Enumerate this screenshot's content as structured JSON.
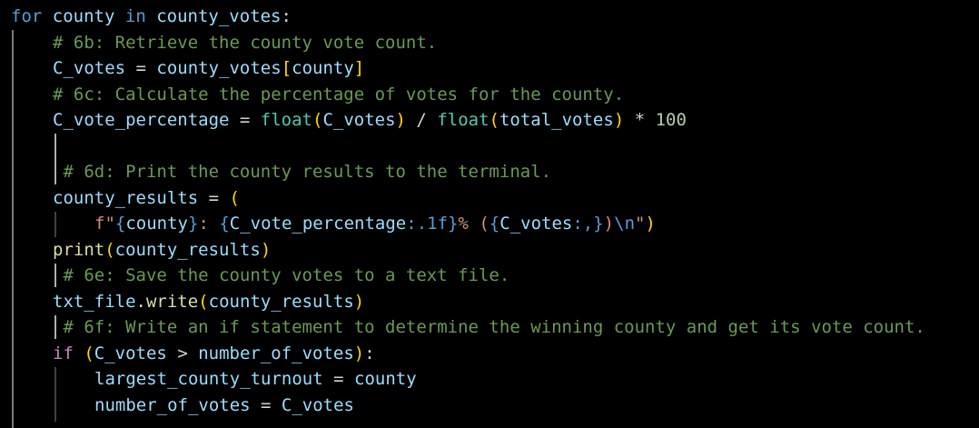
{
  "editor": {
    "colors": {
      "background": "#000000",
      "keyword": "#569cd6",
      "control": "#c586c0",
      "variable": "#9cdcfe",
      "function": "#dcdcaa",
      "builtin": "#4ec9b0",
      "string": "#ce9178",
      "number": "#b5cea8",
      "comment": "#6a9955",
      "plain": "#d4d4d4",
      "bracket1": "#ffd700",
      "bracket2": "#da70d6",
      "bracket3": "#179fff"
    },
    "lines": [
      {
        "indent": 0,
        "tokens": [
          {
            "t": "for",
            "c": "keyword"
          },
          {
            "t": " ",
            "c": "plain"
          },
          {
            "t": "county",
            "c": "variable"
          },
          {
            "t": " ",
            "c": "plain"
          },
          {
            "t": "in",
            "c": "keyword"
          },
          {
            "t": " ",
            "c": "plain"
          },
          {
            "t": "county_votes",
            "c": "variable"
          },
          {
            "t": ":",
            "c": "plain"
          }
        ]
      },
      {
        "indent": 1,
        "tokens": [
          {
            "t": "# 6b: Retrieve the county vote count.",
            "c": "comment"
          }
        ]
      },
      {
        "indent": 1,
        "tokens": [
          {
            "t": "C_votes",
            "c": "variable"
          },
          {
            "t": " = ",
            "c": "plain"
          },
          {
            "t": "county_votes",
            "c": "variable"
          },
          {
            "t": "[",
            "c": "bracket1"
          },
          {
            "t": "county",
            "c": "variable"
          },
          {
            "t": "]",
            "c": "bracket1"
          }
        ]
      },
      {
        "indent": 1,
        "tokens": [
          {
            "t": "# 6c: Calculate the percentage of votes for the county.",
            "c": "comment"
          }
        ]
      },
      {
        "indent": 1,
        "tokens": [
          {
            "t": "C_vote_percentage",
            "c": "variable"
          },
          {
            "t": " = ",
            "c": "plain"
          },
          {
            "t": "float",
            "c": "builtin"
          },
          {
            "t": "(",
            "c": "bracket1"
          },
          {
            "t": "C_votes",
            "c": "variable"
          },
          {
            "t": ")",
            "c": "bracket1"
          },
          {
            "t": " / ",
            "c": "plain"
          },
          {
            "t": "float",
            "c": "builtin"
          },
          {
            "t": "(",
            "c": "bracket1"
          },
          {
            "t": "total_votes",
            "c": "variable"
          },
          {
            "t": ")",
            "c": "bracket1"
          },
          {
            "t": " * ",
            "c": "plain"
          },
          {
            "t": "100",
            "c": "number"
          }
        ]
      },
      {
        "indent": 1,
        "tokens": []
      },
      {
        "indent": 1,
        "tokens": [
          {
            "t": " # 6d: Print the county results to the terminal.",
            "c": "comment"
          }
        ]
      },
      {
        "indent": 1,
        "tokens": [
          {
            "t": "county_results",
            "c": "variable"
          },
          {
            "t": " = ",
            "c": "plain"
          },
          {
            "t": "(",
            "c": "bracket1"
          }
        ]
      },
      {
        "indent": 2,
        "tokens": [
          {
            "t": "f\"",
            "c": "string"
          },
          {
            "t": "{",
            "c": "keyword"
          },
          {
            "t": "county",
            "c": "variable"
          },
          {
            "t": "}",
            "c": "keyword"
          },
          {
            "t": ": ",
            "c": "string"
          },
          {
            "t": "{",
            "c": "keyword"
          },
          {
            "t": "C_vote_percentage",
            "c": "variable"
          },
          {
            "t": ":.1f",
            "c": "keyword"
          },
          {
            "t": "}",
            "c": "keyword"
          },
          {
            "t": "% (",
            "c": "string"
          },
          {
            "t": "{",
            "c": "keyword"
          },
          {
            "t": "C_votes",
            "c": "variable"
          },
          {
            "t": ":,",
            "c": "keyword"
          },
          {
            "t": "}",
            "c": "keyword"
          },
          {
            "t": ")",
            "c": "string"
          },
          {
            "t": "\\n",
            "c": "keyword"
          },
          {
            "t": "\"",
            "c": "string"
          },
          {
            "t": ")",
            "c": "bracket1"
          }
        ]
      },
      {
        "indent": 1,
        "tokens": [
          {
            "t": "print",
            "c": "function"
          },
          {
            "t": "(",
            "c": "bracket1"
          },
          {
            "t": "county_results",
            "c": "variable"
          },
          {
            "t": ")",
            "c": "bracket1"
          }
        ]
      },
      {
        "indent": 1,
        "tokens": [
          {
            "t": " # 6e: Save the county votes to a text file.",
            "c": "comment"
          }
        ]
      },
      {
        "indent": 1,
        "tokens": [
          {
            "t": "txt_file",
            "c": "variable"
          },
          {
            "t": ".",
            "c": "plain"
          },
          {
            "t": "write",
            "c": "function"
          },
          {
            "t": "(",
            "c": "bracket1"
          },
          {
            "t": "county_results",
            "c": "variable"
          },
          {
            "t": ")",
            "c": "bracket1"
          }
        ]
      },
      {
        "indent": 1,
        "tokens": [
          {
            "t": " # 6f: Write an if statement to determine the winning county and get its vote count.",
            "c": "comment"
          }
        ]
      },
      {
        "indent": 1,
        "tokens": [
          {
            "t": "if",
            "c": "control"
          },
          {
            "t": " ",
            "c": "plain"
          },
          {
            "t": "(",
            "c": "bracket1"
          },
          {
            "t": "C_votes",
            "c": "variable"
          },
          {
            "t": " > ",
            "c": "plain"
          },
          {
            "t": "number_of_votes",
            "c": "variable"
          },
          {
            "t": ")",
            "c": "bracket1"
          },
          {
            "t": ":",
            "c": "plain"
          }
        ]
      },
      {
        "indent": 2,
        "tokens": [
          {
            "t": "largest_county_turnout",
            "c": "variable"
          },
          {
            "t": " = ",
            "c": "plain"
          },
          {
            "t": "county",
            "c": "variable"
          }
        ]
      },
      {
        "indent": 2,
        "tokens": [
          {
            "t": "number_of_votes",
            "c": "variable"
          },
          {
            "t": " = ",
            "c": "plain"
          },
          {
            "t": "C_votes",
            "c": "variable"
          }
        ]
      }
    ]
  }
}
